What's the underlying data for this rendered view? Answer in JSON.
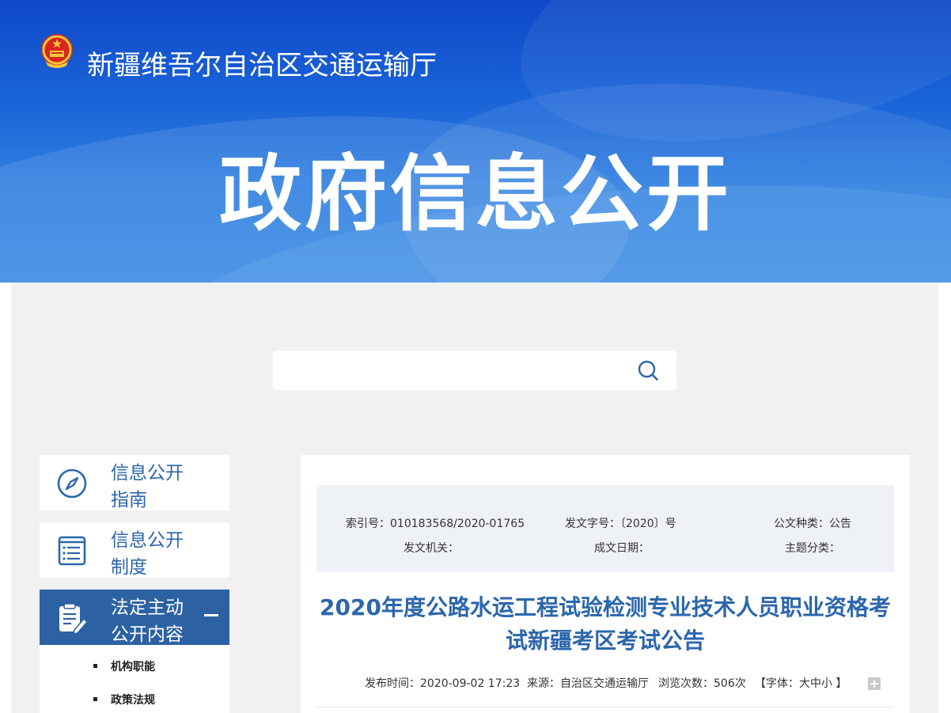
{
  "header": {
    "site_name": "新疆维吾尔自治区交通运输厅",
    "hero_title": "政府信息公开"
  },
  "search": {
    "placeholder": "",
    "icon": "search-icon"
  },
  "sidebar": {
    "items": [
      {
        "label": "信息公开指南",
        "icon": "compass-icon",
        "active": false
      },
      {
        "label": "信息公开制度",
        "icon": "document-list-icon",
        "active": false
      },
      {
        "label": "法定主动公开内容",
        "icon": "clipboard-edit-icon",
        "active": true
      }
    ],
    "subitems": [
      "机构职能",
      "政策法规"
    ]
  },
  "meta": {
    "index_no": "索引号：010183568/2020-01765",
    "doc_no": "发文字号：〔2020〕号",
    "doc_type": "公文种类：公告",
    "issuer": "发文机关：",
    "date_made": "成文日期：",
    "topic": "主题分类："
  },
  "article": {
    "title": "2020年度公路水运工程试验检测专业技术人员职业资格考试新疆考区考试公告",
    "publish_time": "发布时间：2020-09-02 17:23",
    "source": "来源：自治区交通运输厅",
    "views": "浏览次数：506次",
    "font_size": "【字体：大中小 】"
  },
  "colors": {
    "brand_blue": "#2c62a3",
    "title_blue": "#2b66ad",
    "banner_blue": "#1a63d8"
  }
}
